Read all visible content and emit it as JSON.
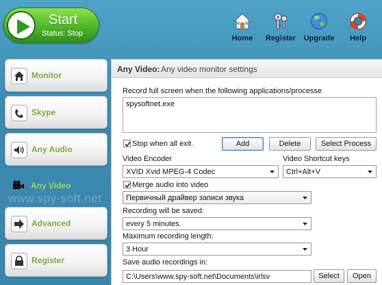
{
  "header": {
    "start": {
      "title": "Start",
      "status": "Status: Stop"
    },
    "buttons": [
      {
        "label": "Home",
        "icon": "home-icon"
      },
      {
        "label": "Register",
        "icon": "keys-icon"
      },
      {
        "label": "Upgrade",
        "icon": "globe-icon"
      },
      {
        "label": "Help",
        "icon": "lifebuoy-icon"
      }
    ]
  },
  "sidebar": {
    "items": [
      {
        "label": "Monitor",
        "icon": "monitor-icon"
      },
      {
        "label": "Skype",
        "icon": "skype-icon"
      },
      {
        "label": "Any Audio",
        "icon": "speaker-icon"
      },
      {
        "label": "Any Video",
        "icon": "video-camera-icon",
        "active": true
      },
      {
        "label": "Advanced",
        "icon": "arrow-icon"
      },
      {
        "label": "Register",
        "icon": "lock-icon"
      }
    ],
    "watermark": "www.spy-soft.net"
  },
  "panel": {
    "title": "Any Video:",
    "subtitle": "Any video monitor settings",
    "record_label": "Record full screen when the following applications/processe",
    "processes_text": "spysoftnet.exe",
    "stop_when_all_exit": {
      "label": "Stop when all exit.",
      "checked": true
    },
    "buttons": {
      "add": "Add",
      "delete": "Delete",
      "select_process": "Select Process"
    },
    "video_encoder": {
      "label": "Video Encoder",
      "value": "XVID Xvid MPEG-4 Codec"
    },
    "shortcut": {
      "label": "Video Shortcut keys",
      "value": "Ctrl+Alt+V"
    },
    "merge_audio": {
      "label": "Merge audio into video",
      "checked": true
    },
    "audio_driver": {
      "value": "Первичный драйвер записи звука"
    },
    "saved": {
      "label": "Recording will be saved:",
      "value": "every 5 minutes."
    },
    "max_length": {
      "label": "Maximum recording length:",
      "value": "3 Hour"
    },
    "save_path": {
      "label": "Save audio recordings in:",
      "value": "C:\\Users\\www.spy-soft.net\\Documents\\irlsv",
      "select": "Select",
      "open": "Open"
    }
  },
  "colors": {
    "background": "#3f8fb4",
    "start_green": "#4eb52a",
    "nav_label": "#7aaa3c",
    "nav_active_label": "#9bd650"
  }
}
